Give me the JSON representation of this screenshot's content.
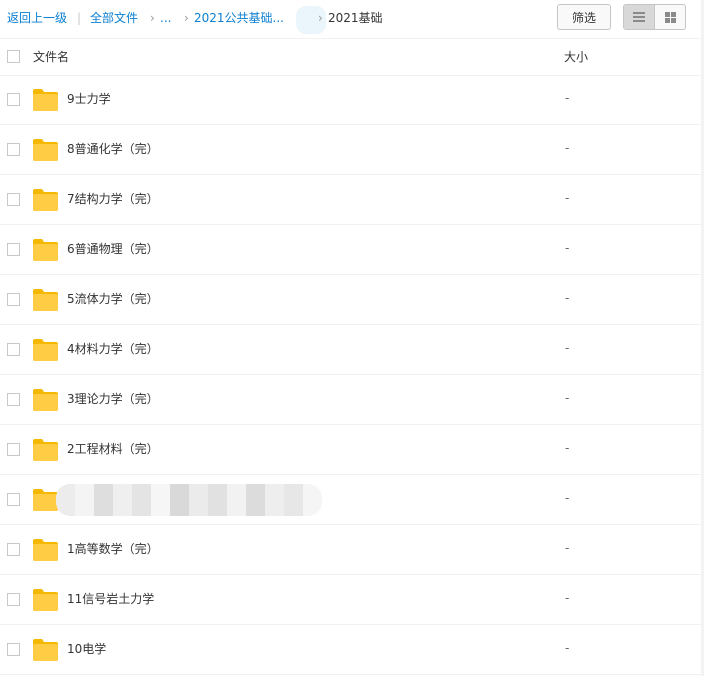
{
  "breadcrumb": {
    "back": "返回上一级",
    "separator": "|",
    "all_files": "全部文件",
    "ellipsis": "...",
    "parent": "2021公共基础...",
    "current": "2021基础"
  },
  "toolbar": {
    "filter_label": "筛选",
    "list_view_icon": "list-icon",
    "grid_view_icon": "grid-icon"
  },
  "table": {
    "col_name": "文件名",
    "col_size": "大小",
    "rows": [
      {
        "name": "9士力学",
        "size": "-"
      },
      {
        "name": "8普通化学（完）",
        "size": "-"
      },
      {
        "name": "7结构力学（完）",
        "size": "-"
      },
      {
        "name": "6普通物理（完）",
        "size": "-"
      },
      {
        "name": "5流体力学（完）",
        "size": "-"
      },
      {
        "name": "4材料力学（完）",
        "size": "-"
      },
      {
        "name": "3理论力学（完）",
        "size": "-"
      },
      {
        "name": "2工程材料（完）",
        "size": "-"
      },
      {
        "name": "",
        "size": "-"
      },
      {
        "name": "1高等数学（完）",
        "size": "-"
      },
      {
        "name": "11信号岩土力学",
        "size": "-"
      },
      {
        "name": "10电学",
        "size": "-"
      }
    ]
  },
  "colors": {
    "link": "#0b7fd1",
    "folder": "#ffcc44",
    "folder_tab": "#f5b800"
  }
}
